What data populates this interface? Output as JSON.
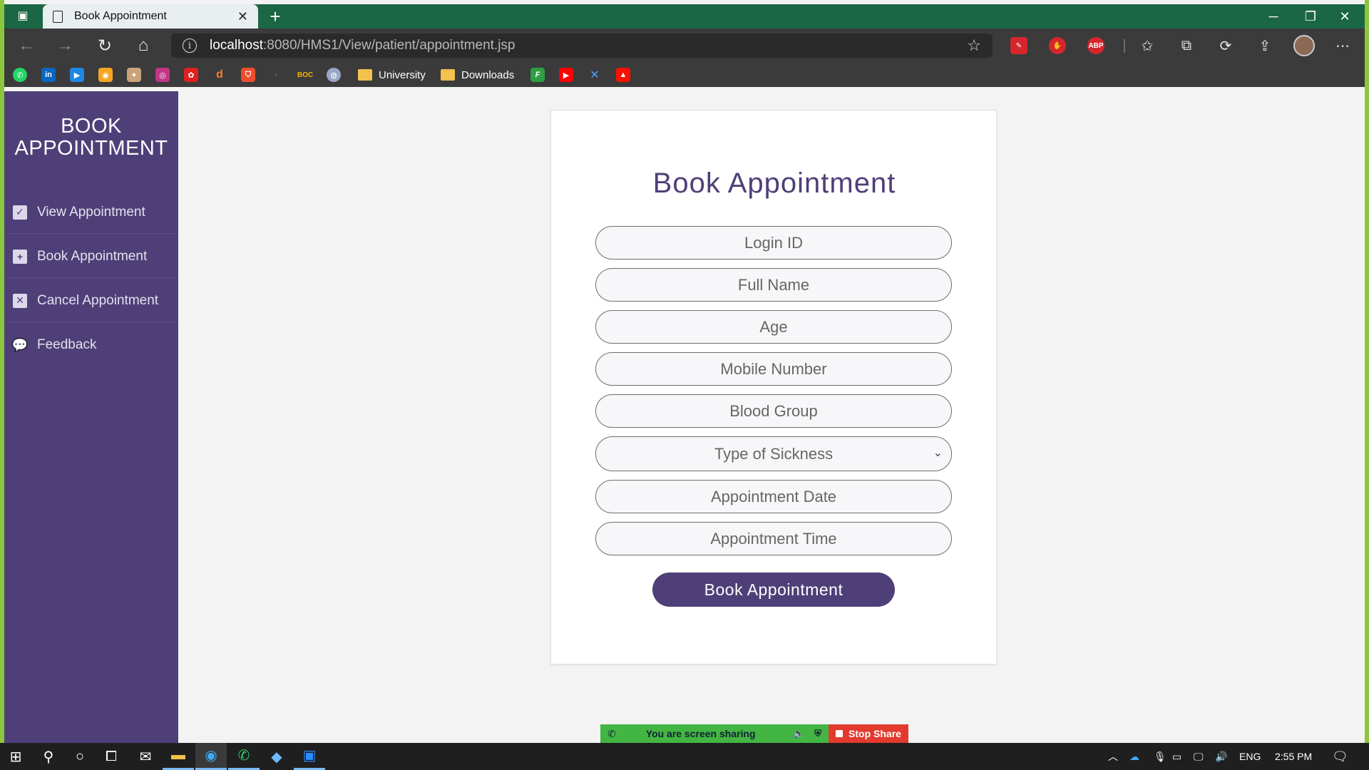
{
  "browser": {
    "tab_title": "Book Appointment",
    "url_host": "localhost",
    "url_path": ":8080/HMS1/View/patient/appointment.jsp",
    "bookmarks": [
      {
        "label": "University"
      },
      {
        "label": "Downloads"
      }
    ],
    "icons": {
      "linkedin": "in",
      "abp": "ABP",
      "boc": "BOC"
    }
  },
  "sidebar": {
    "brand_line1": "BOOK",
    "brand_line2": "APPOINTMENT",
    "items": [
      {
        "label": "View Appointment",
        "icon": "calendar-check-icon"
      },
      {
        "label": "Book Appointment",
        "icon": "calendar-plus-icon"
      },
      {
        "label": "Cancel Appointment",
        "icon": "close-box-icon"
      },
      {
        "label": "Feedback",
        "icon": "comments-icon"
      }
    ]
  },
  "form": {
    "title": "Book Appointment",
    "login_id_placeholder": "Login ID",
    "full_name_placeholder": "Full Name",
    "age_placeholder": "Age",
    "mobile_placeholder": "Mobile Number",
    "blood_group_placeholder": "Blood Group",
    "sickness_selected": "Type of Sickness",
    "date_placeholder": "Appointment Date",
    "time_placeholder": "Appointment Time",
    "submit_label": "Book Appointment"
  },
  "share_bar": {
    "status": "You are screen sharing",
    "stop_label": "Stop Share"
  },
  "taskbar": {
    "language": "ENG",
    "time": "2:55 PM"
  },
  "colors": {
    "sidebar_bg": "#4e3f78",
    "accent": "#4e3f78",
    "browser_tabbar": "#1b6645",
    "share_green": "#43b543",
    "stop_red": "#e23b2e"
  }
}
